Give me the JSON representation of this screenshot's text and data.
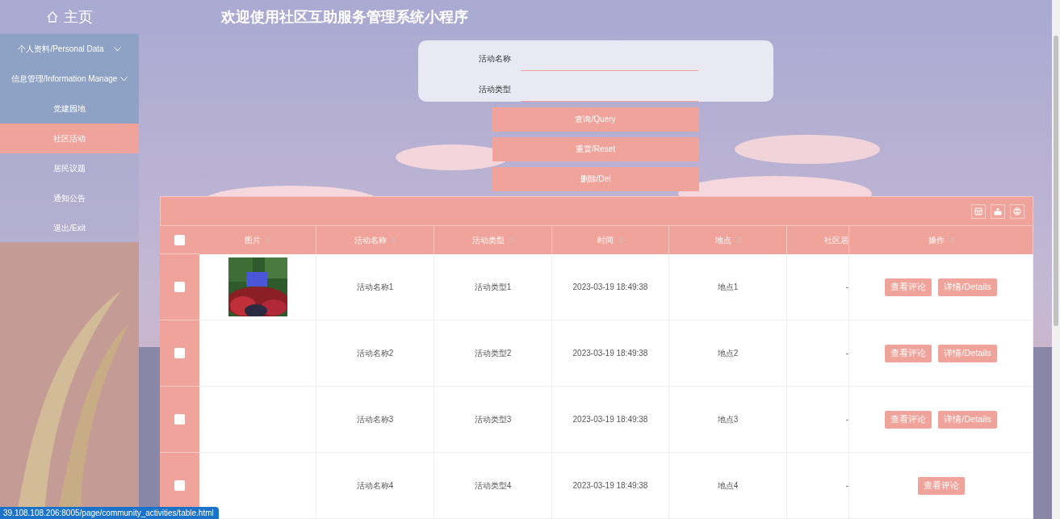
{
  "sidebar": {
    "home": "主页",
    "items": [
      {
        "label": "个人资料/Personal Data",
        "kind": "group",
        "expanded": false,
        "selected": false
      },
      {
        "label": "信息管理/Information Manage",
        "kind": "group",
        "expanded": true,
        "selected": false
      },
      {
        "label": "党建园地",
        "kind": "link",
        "selected": false
      },
      {
        "label": "社区活动",
        "kind": "link",
        "selected": true
      },
      {
        "label": "居民议题",
        "kind": "link",
        "selected": false
      },
      {
        "label": "通知公告",
        "kind": "link",
        "selected": false
      },
      {
        "label": "退出/Exit",
        "kind": "link",
        "selected": false
      }
    ]
  },
  "header": {
    "title": "欢迎使用社区互助服务管理系统小程序"
  },
  "search": {
    "fields": [
      {
        "label": "活动名称"
      },
      {
        "label": "活动类型"
      }
    ],
    "buttons": [
      "查询/Query",
      "重置/Reset",
      "删除/Del"
    ]
  },
  "table": {
    "columns": [
      {
        "label": "图片",
        "sortable": true
      },
      {
        "label": "活动名称",
        "sortable": true
      },
      {
        "label": "活动类型",
        "sortable": true
      },
      {
        "label": "时间",
        "sortable": true
      },
      {
        "label": "地点",
        "sortable": true
      },
      {
        "label": "社区居",
        "sortable": false
      },
      {
        "label": "操作",
        "sortable": true
      }
    ],
    "rows": [
      {
        "checked": false,
        "image": {
          "kind": "picture"
        },
        "name": "活动名称1",
        "type": "活动类型1",
        "time": "2023-03-19 18:49:38",
        "place": "地点1",
        "column_6": "-",
        "actions": [
          "查看评论",
          "详情/Details"
        ]
      },
      {
        "checked": false,
        "name": "活动名称2",
        "type": "活动类型2",
        "time": "2023-03-19 18:49:38",
        "place": "地点2",
        "column_6": "-",
        "actions": [
          "查看评论",
          "详情/Details"
        ]
      },
      {
        "checked": false,
        "name": "活动名称3",
        "type": "活动类型3",
        "time": "2023-03-19 18:49:38",
        "place": "地点3",
        "column_6": "-",
        "actions": [
          "查看评论",
          "详情/Details"
        ]
      },
      {
        "checked": false,
        "name": "活动名称4",
        "type": "活动类型4",
        "time": "2023-03-19 18:49:38",
        "place": "地点4",
        "column_6": "-",
        "actions": [
          "查看评论"
        ]
      }
    ],
    "select_all": {
      "checked": false
    }
  },
  "status_bar": {
    "url": "39.108.108.206:8005/page/community_activities/table.html"
  }
}
